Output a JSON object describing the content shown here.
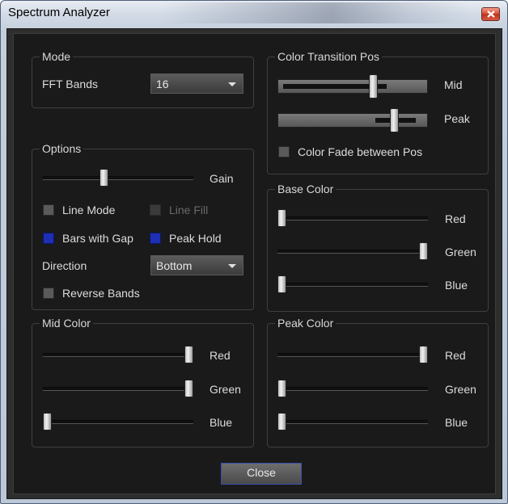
{
  "window": {
    "title": "Spectrum Analyzer"
  },
  "mode": {
    "group_label": "Mode",
    "fft_label": "FFT Bands",
    "fft_value": "16"
  },
  "options": {
    "group_label": "Options",
    "gain_label": "Gain",
    "gain_level": 0.4,
    "line_mode": {
      "label": "Line Mode",
      "checked": false
    },
    "line_fill": {
      "label": "Line Fill",
      "checked": false,
      "enabled": false
    },
    "bars_with_gap": {
      "label": "Bars with Gap",
      "checked": true
    },
    "peak_hold": {
      "label": "Peak Hold",
      "checked": true
    },
    "direction_label": "Direction",
    "direction_value": "Bottom",
    "reverse_bands": {
      "label": "Reverse Bands",
      "checked": false
    }
  },
  "color_transition": {
    "group_label": "Color Transition Pos",
    "mid_label": "Mid",
    "mid_level": 0.65,
    "peak_label": "Peak",
    "peak_level": 0.8,
    "fade_label": "Color Fade between Pos",
    "fade_checked": false
  },
  "base_color": {
    "group_label": "Base Color",
    "red_label": "Red",
    "red": 0.0,
    "green_label": "Green",
    "green": 1.0,
    "blue_label": "Blue",
    "blue": 0.0
  },
  "mid_color": {
    "group_label": "Mid Color",
    "red_label": "Red",
    "red": 1.0,
    "green_label": "Green",
    "green": 1.0,
    "blue_label": "Blue",
    "blue": 0.0
  },
  "peak_color": {
    "group_label": "Peak Color",
    "red_label": "Red",
    "red": 1.0,
    "green_label": "Green",
    "green": 0.0,
    "blue_label": "Blue",
    "blue": 0.0
  },
  "footer": {
    "close_label": "Close"
  },
  "colors": {
    "accent_checked": "#1d2fb4",
    "panel_bg": "#1a1a1a"
  }
}
